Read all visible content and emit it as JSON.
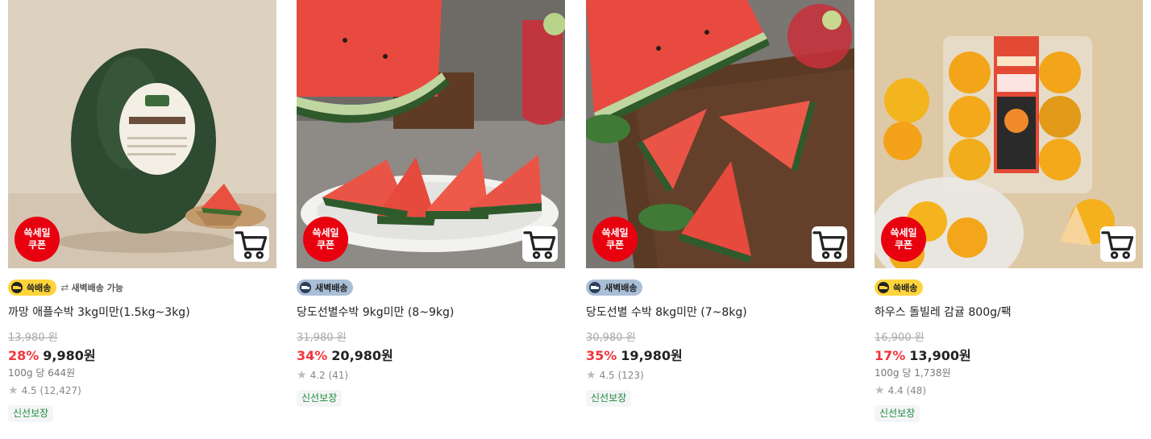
{
  "products": [
    {
      "image": "watermelon-apple-image",
      "sale_badge": "쓱세일\n쿠폰",
      "delivery": {
        "badge": "쓱배송",
        "style": "yellow",
        "extra": "새벽배송 가능",
        "extra_icon": "swap-icon"
      },
      "name": "까망 애플수박 3kg미만(1.5kg~3kg)",
      "original_price": "13,980 원",
      "discount": "28%",
      "price": "9,980원",
      "unit_price": "100g 당 644원",
      "rating": "4.5",
      "reviews": "(12,427)",
      "tag": "신선보장"
    },
    {
      "image": "watermelon-slices-image",
      "sale_badge": "쓱세일\n쿠폰",
      "delivery": {
        "badge": "새벽배송",
        "style": "blue"
      },
      "name": "당도선별수박 9kg미만 (8~9kg)",
      "original_price": "31,980 원",
      "discount": "34%",
      "price": "20,980원",
      "unit_price": "",
      "rating": "4.2",
      "reviews": "(41)",
      "tag": "신선보장"
    },
    {
      "image": "watermelon-board-image",
      "sale_badge": "쓱세일\n쿠폰",
      "delivery": {
        "badge": "새벽배송",
        "style": "blue"
      },
      "name": "당도선별 수박 8kg미만 (7~8kg)",
      "original_price": "30,980 원",
      "discount": "35%",
      "price": "19,980원",
      "unit_price": "",
      "rating": "4.5",
      "reviews": "(123)",
      "tag": "신선보장"
    },
    {
      "image": "tangerine-pack-image",
      "sale_badge": "쓱세일\n쿠폰",
      "delivery": {
        "badge": "쓱배송",
        "style": "yellow"
      },
      "name": "하우스 돌빌레 감귤 800g/팩",
      "original_price": "16,900 원",
      "discount": "17%",
      "price": "13,900원",
      "unit_price": "100g 당 1,738원",
      "rating": "4.4",
      "reviews": "(48)",
      "tag": "신선보장"
    }
  ],
  "colors": {
    "sale_red": "#e8000f",
    "discount_red": "#f1353c",
    "ssg_yellow": "#ffd43b",
    "dawn_blue": "#a9bfd6",
    "fresh_green": "#1b8a3d"
  }
}
